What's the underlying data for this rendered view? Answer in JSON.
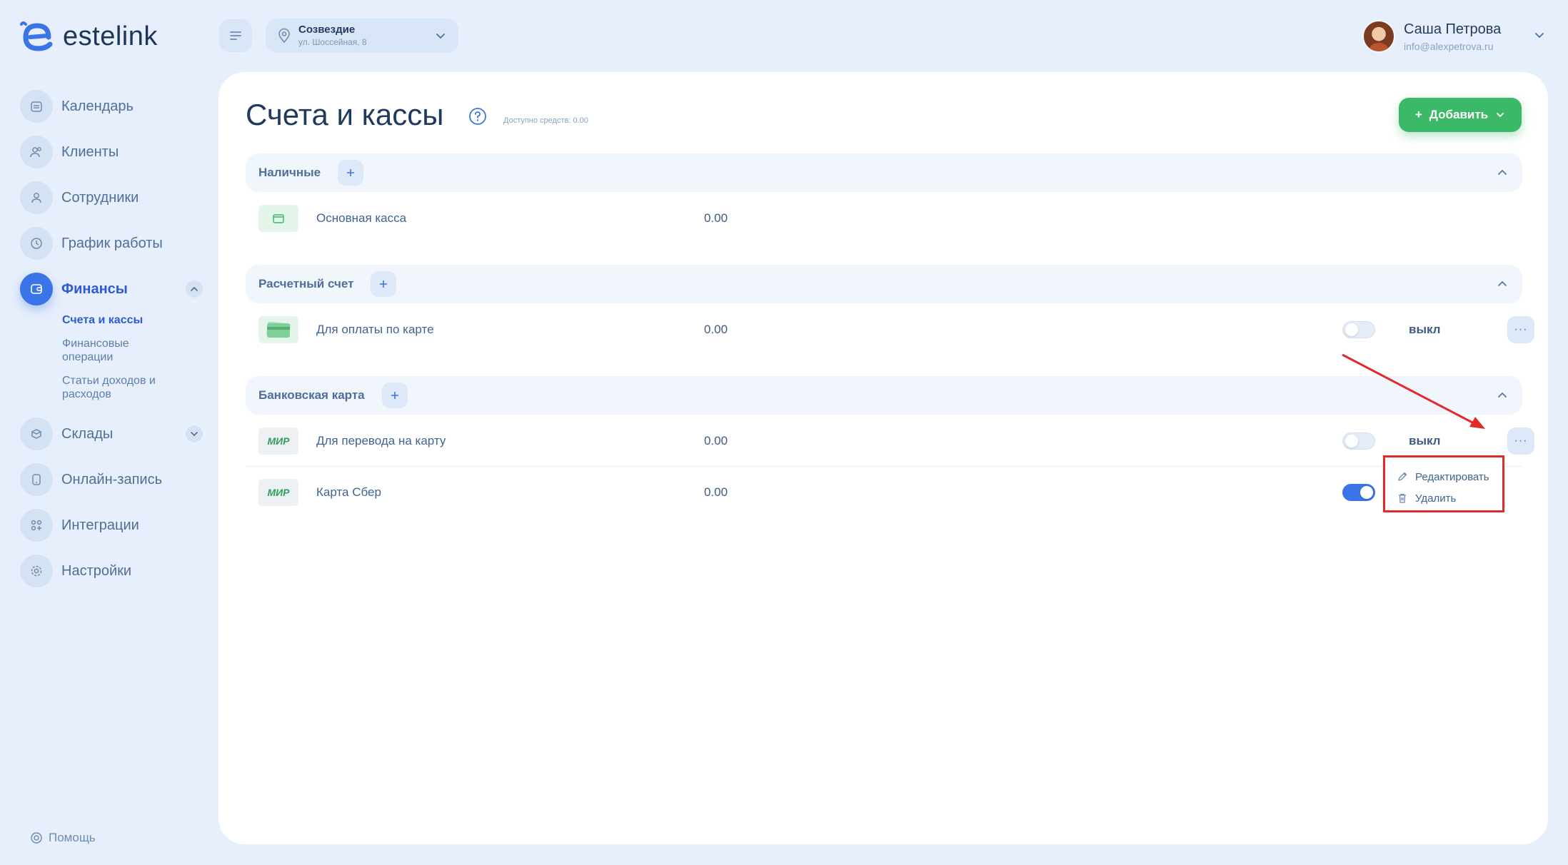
{
  "brand": {
    "logo_text": "estelink"
  },
  "topbar": {
    "menu_icon": "menu-lines-icon",
    "location": {
      "name": "Созвездие",
      "address": "ул. Шоссейная, 8",
      "icon": "map-pin-icon"
    },
    "user": {
      "name": "Саша Петрова",
      "email": "info@alexpetrova.ru"
    }
  },
  "sidebar": {
    "items": [
      {
        "label": "Календарь",
        "icon": "calendar-icon"
      },
      {
        "label": "Клиенты",
        "icon": "users-icon"
      },
      {
        "label": "Сотрудники",
        "icon": "user-icon"
      },
      {
        "label": "График работы",
        "icon": "clock-icon"
      },
      {
        "label": "Финансы",
        "icon": "wallet-icon",
        "active": true
      },
      {
        "label": "Склады",
        "icon": "box-icon"
      },
      {
        "label": "Онлайн-запись",
        "icon": "phone-icon"
      },
      {
        "label": "Интеграции",
        "icon": "grid-plus-icon"
      },
      {
        "label": "Настройки",
        "icon": "gear-icon"
      }
    ],
    "finance_sub": [
      {
        "label": "Счета и кассы",
        "active": true
      },
      {
        "label": "Финансовые операции"
      },
      {
        "label": "Статьи доходов и расходов"
      }
    ],
    "help_label": "Помощь"
  },
  "main": {
    "title": "Счета и кассы",
    "available": "Доступно средств: 0.00",
    "add_button": "Добавить",
    "sections": [
      {
        "title": "Наличные",
        "rows": [
          {
            "name": "Основная касса",
            "amount": "0.00",
            "icon": "wallet-cash-icon"
          }
        ]
      },
      {
        "title": "Расчетный счет",
        "rows": [
          {
            "name": "Для оплаты по карте",
            "amount": "0.00",
            "icon": "bank-card-icon",
            "toggle": "выкл",
            "toggle_on": false
          }
        ]
      },
      {
        "title": "Банковская карта",
        "rows": [
          {
            "name": "Для перевода на карту",
            "amount": "0.00",
            "icon": "mir-logo",
            "icon_text": "МИР",
            "toggle": "выкл",
            "toggle_on": false
          },
          {
            "name": "Карта Сбер",
            "amount": "0.00",
            "icon": "mir-logo",
            "icon_text": "МИР",
            "toggle_on": true
          }
        ]
      }
    ],
    "more_label": "···",
    "context_menu": {
      "edit": "Редактировать",
      "delete": "Удалить"
    }
  },
  "colors": {
    "accent": "#3b74e6",
    "add_button": "#3cb968",
    "annotation": "#e32a2a",
    "background": "#e6effb"
  }
}
